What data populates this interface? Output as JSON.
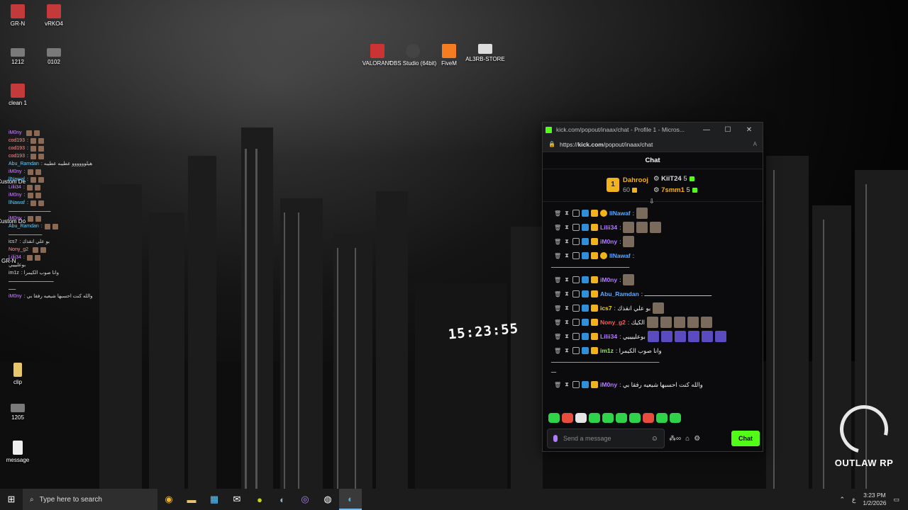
{
  "desktop": {
    "icons": [
      {
        "label": "GR-N",
        "color": "#c43a3a"
      },
      {
        "label": "vRKO4",
        "color": "#c43a3a"
      },
      {
        "label": "1212",
        "color": "#7a7a7a"
      },
      {
        "label": "0102",
        "color": "#7a7a7a"
      },
      {
        "label": "clean 1",
        "color": "#c43a3a"
      },
      {
        "label": "VALORANT",
        "color": "#c33"
      },
      {
        "label": "OBS Studio (64bit)",
        "color": "#444"
      },
      {
        "label": "FiveM",
        "color": "#f57c20"
      },
      {
        "label": "AL3RB-STORE",
        "color": "#ddd"
      },
      {
        "label": "clip",
        "color": "#e6c56b"
      },
      {
        "label": "1205",
        "color": "#7a7a7a"
      },
      {
        "label": "message",
        "color": "#eee"
      }
    ],
    "sign_time": "15:23:55",
    "overlay_partial": [
      "Custom De",
      "Custom Do",
      "GR-N"
    ]
  },
  "overlay": {
    "rows": [
      {
        "name": "iM0ny",
        "cls": "n3",
        "text": ""
      },
      {
        "name": "cod193",
        "cls": "n2",
        "text": ":"
      },
      {
        "name": "cod193",
        "cls": "n2",
        "text": ":"
      },
      {
        "name": "cod193",
        "cls": "n2",
        "text": ":"
      },
      {
        "name": "Abu_Ramdan",
        "cls": "n",
        "text": ": هيلوووووو عطيبه عطيبه"
      },
      {
        "name": "iM0ny",
        "cls": "n3",
        "text": ":"
      },
      {
        "name": "llNawaf",
        "cls": "n",
        "text": ":"
      },
      {
        "name": "Lilii34",
        "cls": "n3",
        "text": ":"
      },
      {
        "name": "iM0ny",
        "cls": "n3",
        "text": ":"
      },
      {
        "name": "llNawaf",
        "cls": "n",
        "text": ":"
      },
      {
        "name": "",
        "cls": "",
        "text": "ـــــــــــــــــــــــــــــ"
      },
      {
        "name": "iM0ny",
        "cls": "n3",
        "text": ":"
      },
      {
        "name": "Abu_Ramdan",
        "cls": "n",
        "text": ":"
      },
      {
        "name": "",
        "cls": "",
        "text": "ـــــــــــــــــــــــ"
      },
      {
        "name": "ics7",
        "cls": "",
        "text": ": بو علي انقذك"
      },
      {
        "name": "Nony_g2",
        "cls": "n2",
        "text": ""
      },
      {
        "name": "Lilii34",
        "cls": "n3",
        "text": ":"
      },
      {
        "name": "",
        "cls": "",
        "text": "بوعليييي"
      },
      {
        "name": "im1z",
        "cls": "",
        "text": ": وانا صوب الكيمرا"
      },
      {
        "name": "",
        "cls": "",
        "text": "ـــــــــــــــــــــــــــــــ"
      },
      {
        "name": "",
        "cls": "",
        "text": "ـــــ"
      },
      {
        "name": "iM0ny",
        "cls": "n3",
        "text": ": والله كنت احسبها شيعيه رفقا بي"
      }
    ]
  },
  "browser": {
    "title": "kick.com/popout/inaax/chat - Profile 1 - Micros...",
    "url_prefix": "https://",
    "url_host": "kick.com",
    "url_path": "/popout/inaax/chat",
    "minimize": "—",
    "maximize": "☐",
    "close": "✕",
    "read_aloud": "A"
  },
  "chat": {
    "header": "Chat",
    "leaderboard": {
      "first_rank": "1",
      "first_name": "Dahrooj",
      "first_score": "60",
      "second_name": "KiiT24",
      "second_score": "5",
      "third_name": "7smm1",
      "third_score": "5"
    },
    "messages": [
      {
        "user": "llNawaf",
        "cls": "b",
        "text": ":",
        "emotes": 1
      },
      {
        "user": "Lilii34",
        "cls": "p",
        "text": ":",
        "emotes": 3
      },
      {
        "user": "iM0ny",
        "cls": "p",
        "text": ":",
        "emotes": 1
      },
      {
        "user": "llNawaf",
        "cls": "b",
        "text": ":",
        "emotes": 0
      },
      {
        "user": "",
        "cls": "",
        "text": "ـــــــــــــــــــــــــــــــــــــــــــــــ",
        "line": true
      },
      {
        "user": "iM0ny",
        "cls": "p",
        "text": ":",
        "emotes": 1
      },
      {
        "user": "Abu_Ramdan",
        "cls": "b",
        "text": ": ــــــــــــــــــــــــــــــــــــــ",
        "emotes": 0
      },
      {
        "user": "ics7",
        "cls": "y",
        "text": ": بو علي انقذك",
        "emotes": 1
      },
      {
        "user": "Nony_g2",
        "cls": "r",
        "text": ": الكيك",
        "emotes": 5
      },
      {
        "user": "Lilii34",
        "cls": "p",
        "text": ": بوعلييييي",
        "emotes": 6,
        "blue": true
      },
      {
        "user": "im1z",
        "cls": "g",
        "text": ": وانا صوب الكيمرا",
        "emotes": 0
      },
      {
        "user": "",
        "cls": "",
        "text": "ـــــــــــــــــــــــــــــــــــــــــــــــــــــــــــــــــ",
        "line": true
      },
      {
        "user": "",
        "cls": "",
        "text": "ـــ",
        "line": true
      },
      {
        "user": "iM0ny",
        "cls": "p",
        "text": ": والله كنت احسبها شيعيه رفقا بي",
        "emotes": 0
      }
    ],
    "placeholder": "Send a message",
    "send_label": "Chat"
  },
  "logo": {
    "text": "OUTLAW RP"
  },
  "taskbar": {
    "search_placeholder": "Type here to search",
    "lang": "ع",
    "time": "3:23 PM",
    "date": "1/2/2026"
  }
}
